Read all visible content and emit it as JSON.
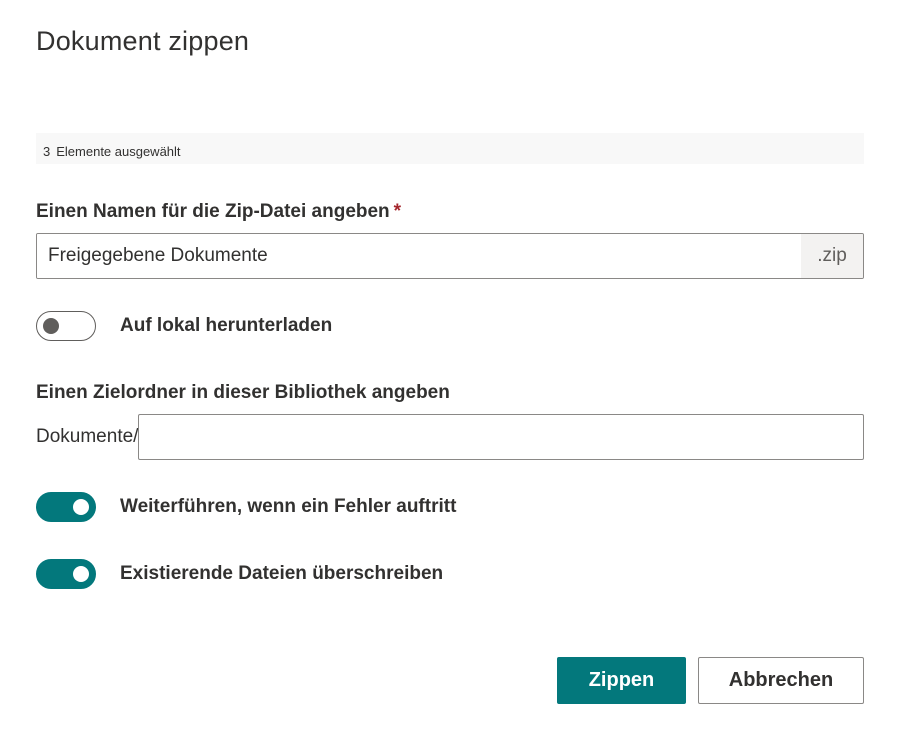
{
  "dialog": {
    "title": "Dokument zippen"
  },
  "selection": {
    "count": "3",
    "text": "Elemente ausgewählt"
  },
  "zip_name": {
    "label": "Einen Namen für die Zip-Datei angeben",
    "required_marker": "*",
    "value": "Freigegebene Dokumente",
    "suffix": ".zip"
  },
  "download_local": {
    "label": "Auf lokal herunterladen",
    "checked": false
  },
  "target_folder": {
    "label": "Einen Zielordner in dieser Bibliothek angeben",
    "prefix": "Dokumente/",
    "value": ""
  },
  "continue_on_error": {
    "label": "Weiterführen, wenn ein Fehler auftritt",
    "checked": true
  },
  "overwrite_existing": {
    "label": "Existierende Dateien überschreiben",
    "checked": true
  },
  "actions": {
    "primary_label": "Zippen",
    "cancel_label": "Abbrechen"
  },
  "colors": {
    "accent": "#03787c",
    "required": "#a4262c",
    "text": "#323130"
  }
}
